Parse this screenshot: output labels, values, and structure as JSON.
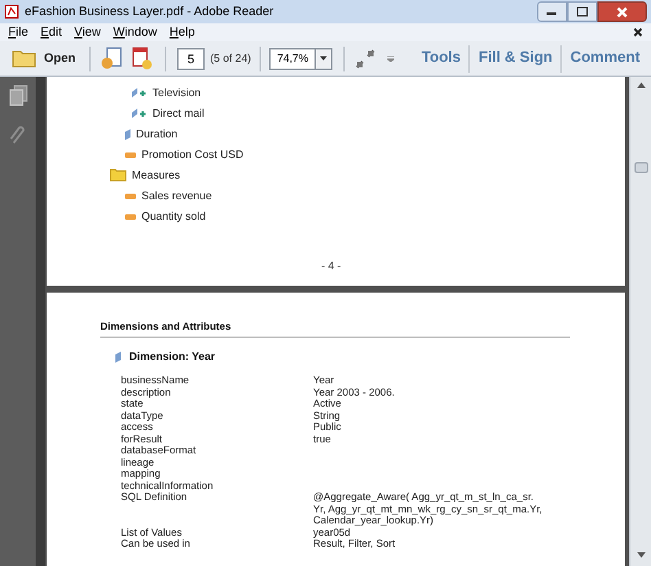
{
  "window": {
    "title": "eFashion Business Layer.pdf - Adobe Reader"
  },
  "menu": [
    "File",
    "Edit",
    "View",
    "Window",
    "Help"
  ],
  "toolbar": {
    "open": "Open",
    "page": "5",
    "page_count": "(5 of 24)",
    "zoom": "74,7%",
    "tools": [
      "Tools",
      "Fill & Sign",
      "Comment"
    ]
  },
  "page_1": {
    "tree": [
      {
        "kind": "attribute",
        "label": "Television"
      },
      {
        "kind": "attribute",
        "label": "Direct mail"
      },
      {
        "kind": "dimension",
        "label": "Duration"
      },
      {
        "kind": "measure",
        "label": "Promotion Cost USD"
      },
      {
        "kind": "folder",
        "label": "Measures",
        "children": [
          {
            "kind": "measure",
            "label": "Sales revenue"
          },
          {
            "kind": "measure",
            "label": "Quantity sold"
          }
        ]
      }
    ],
    "page_number": "- 4 -"
  },
  "page_2": {
    "heading": "Dimensions and Attributes",
    "dimension": "Dimension: Year",
    "properties": [
      {
        "name": "businessName",
        "value": "Year"
      },
      {
        "name": "description",
        "value": "Year 2003 - 2006."
      },
      {
        "name": "state",
        "value": "Active"
      },
      {
        "name": "dataType",
        "value": "String"
      },
      {
        "name": "access",
        "value": "Public"
      },
      {
        "name": "forResult",
        "value": "true"
      },
      {
        "name": "databaseFormat"
      },
      {
        "name": "lineage"
      },
      {
        "name": "mapping"
      },
      {
        "name": "technicalInformation"
      },
      {
        "name": "SQL Definition",
        "value": "@Aggregate_Aware( Agg_yr_qt_m_st_ln_ca_sr.\nYr, Agg_yr_qt_mt_mn_wk_rg_cy_sn_sr_qt_ma.Yr,\nCalendar_year_lookup.Yr)"
      },
      {
        "name": "List of Values",
        "value": "year05d"
      },
      {
        "name": "Can be used in",
        "value": "Result, Filter, Sort"
      }
    ]
  }
}
